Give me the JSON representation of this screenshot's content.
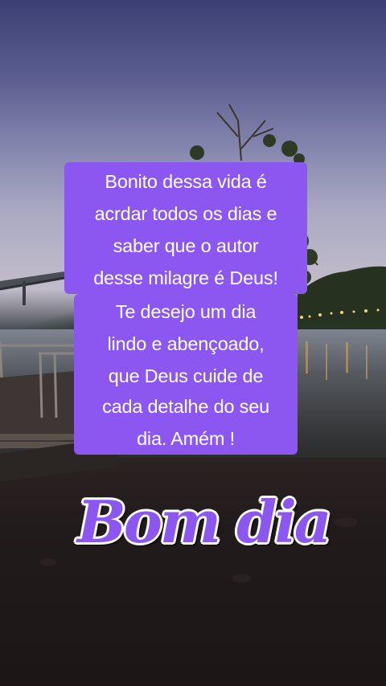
{
  "message": {
    "lines": [
      "Bonito dessa vida é",
      "acrdar todos os dias e",
      "saber que o autor",
      "desse milagre é Deus!",
      "Te desejo um dia",
      "lindo e abençoado,",
      "que Deus cuide de",
      "cada detalhe do seu",
      "dia. Amém !"
    ]
  },
  "greeting": "Bom dia",
  "colors": {
    "accent": "#8c57f0",
    "text": "#ffffff"
  },
  "scene": {
    "description_icons": [
      "lake-icon",
      "tree-icon",
      "dock-icon",
      "shore-lights-icon"
    ]
  }
}
